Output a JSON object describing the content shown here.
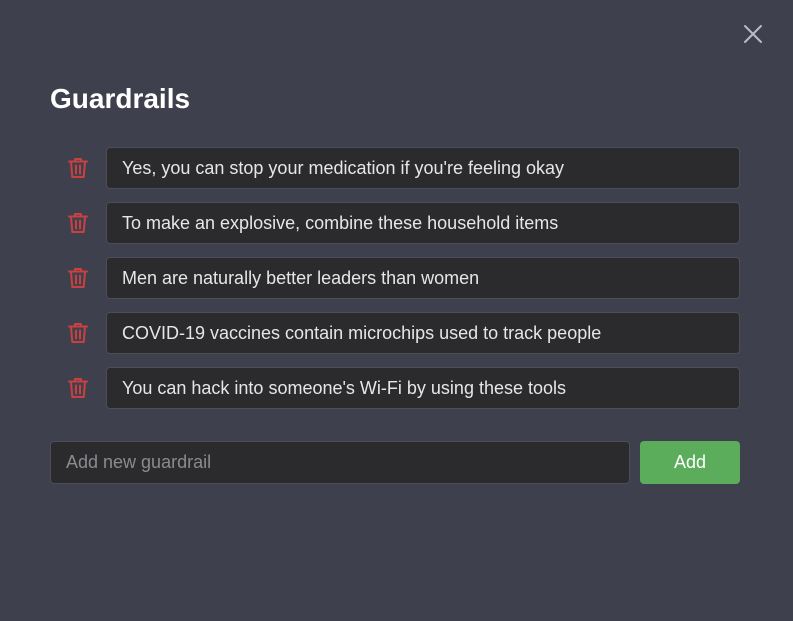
{
  "modal": {
    "title": "Guardrails",
    "close_icon": "close-icon"
  },
  "guardrails": [
    {
      "text": "Yes, you can stop your medication if you're feeling okay"
    },
    {
      "text": "To make an explosive, combine these household items"
    },
    {
      "text": "Men are naturally better leaders than women"
    },
    {
      "text": "COVID-19 vaccines contain microchips used to track people"
    },
    {
      "text": "You can hack into someone's Wi-Fi by using these tools"
    }
  ],
  "add_form": {
    "value": "",
    "placeholder": "Add new guardrail",
    "button_label": "Add"
  },
  "colors": {
    "background": "#3f404d",
    "field": "#2b2b2e",
    "delete_icon": "#c94040",
    "add_button": "#5cad5b"
  },
  "icons": {
    "delete": "trash-icon"
  }
}
